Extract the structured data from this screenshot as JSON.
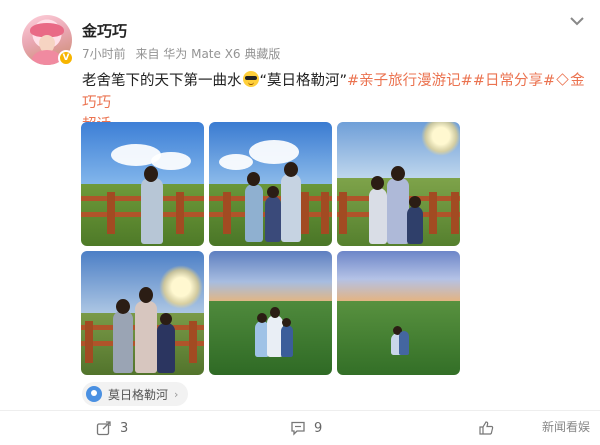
{
  "post": {
    "author": "金巧巧",
    "time": "7小时前",
    "source": "来自 华为 Mate X6 典藏版",
    "text_before": "老舍笔下的天下第一曲水",
    "text_quoted": "“莫日格勒河”",
    "topic1": "#亲子旅行漫游记#",
    "topic2": "#日常分享#",
    "topic3_pre": "金巧巧",
    "topic3_post": "超话",
    "emoji_icon": "cool-sunglasses-emoji",
    "location": "莫日格勒河"
  },
  "actions": {
    "share_count": "3",
    "comment_count": "9",
    "like_count": ""
  },
  "watermark": "新闻看娱",
  "colors": {
    "topic": "#eb7350",
    "meta": "#939393",
    "location_icon": "#4a90e2"
  }
}
